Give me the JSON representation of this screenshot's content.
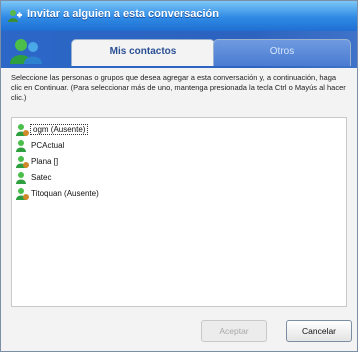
{
  "window": {
    "title": "Invitar a alguien a esta conversación"
  },
  "tabs": [
    {
      "label": "Mis contactos",
      "active": true
    },
    {
      "label": "Otros",
      "active": false
    }
  ],
  "instructions": "Seleccione las personas o grupos que desea agregar a esta conversación y, a continuación, haga clic en Continuar. (Para seleccionar más de uno, mantenga presionada la tecla Ctrl o Mayús al hacer clic.)",
  "contacts": [
    {
      "label": "ogm (Ausente)",
      "status_icon": "contact-away-icon",
      "selected": true
    },
    {
      "label": "PCActual",
      "status_icon": "contact-online-icon",
      "selected": false
    },
    {
      "label": "Plana []",
      "status_icon": "contact-away-icon",
      "selected": false
    },
    {
      "label": "Satec",
      "status_icon": "contact-online-icon",
      "selected": false
    },
    {
      "label": "Titoquan (Ausente)",
      "status_icon": "contact-away-icon",
      "selected": false
    }
  ],
  "buttons": {
    "accept_label": "Aceptar",
    "cancel_label": "Cancelar"
  },
  "colors": {
    "titlebar": "#2f8ae5",
    "header": "#2c67c7",
    "online": "#2e9f3e",
    "away": "#d08a2a"
  }
}
